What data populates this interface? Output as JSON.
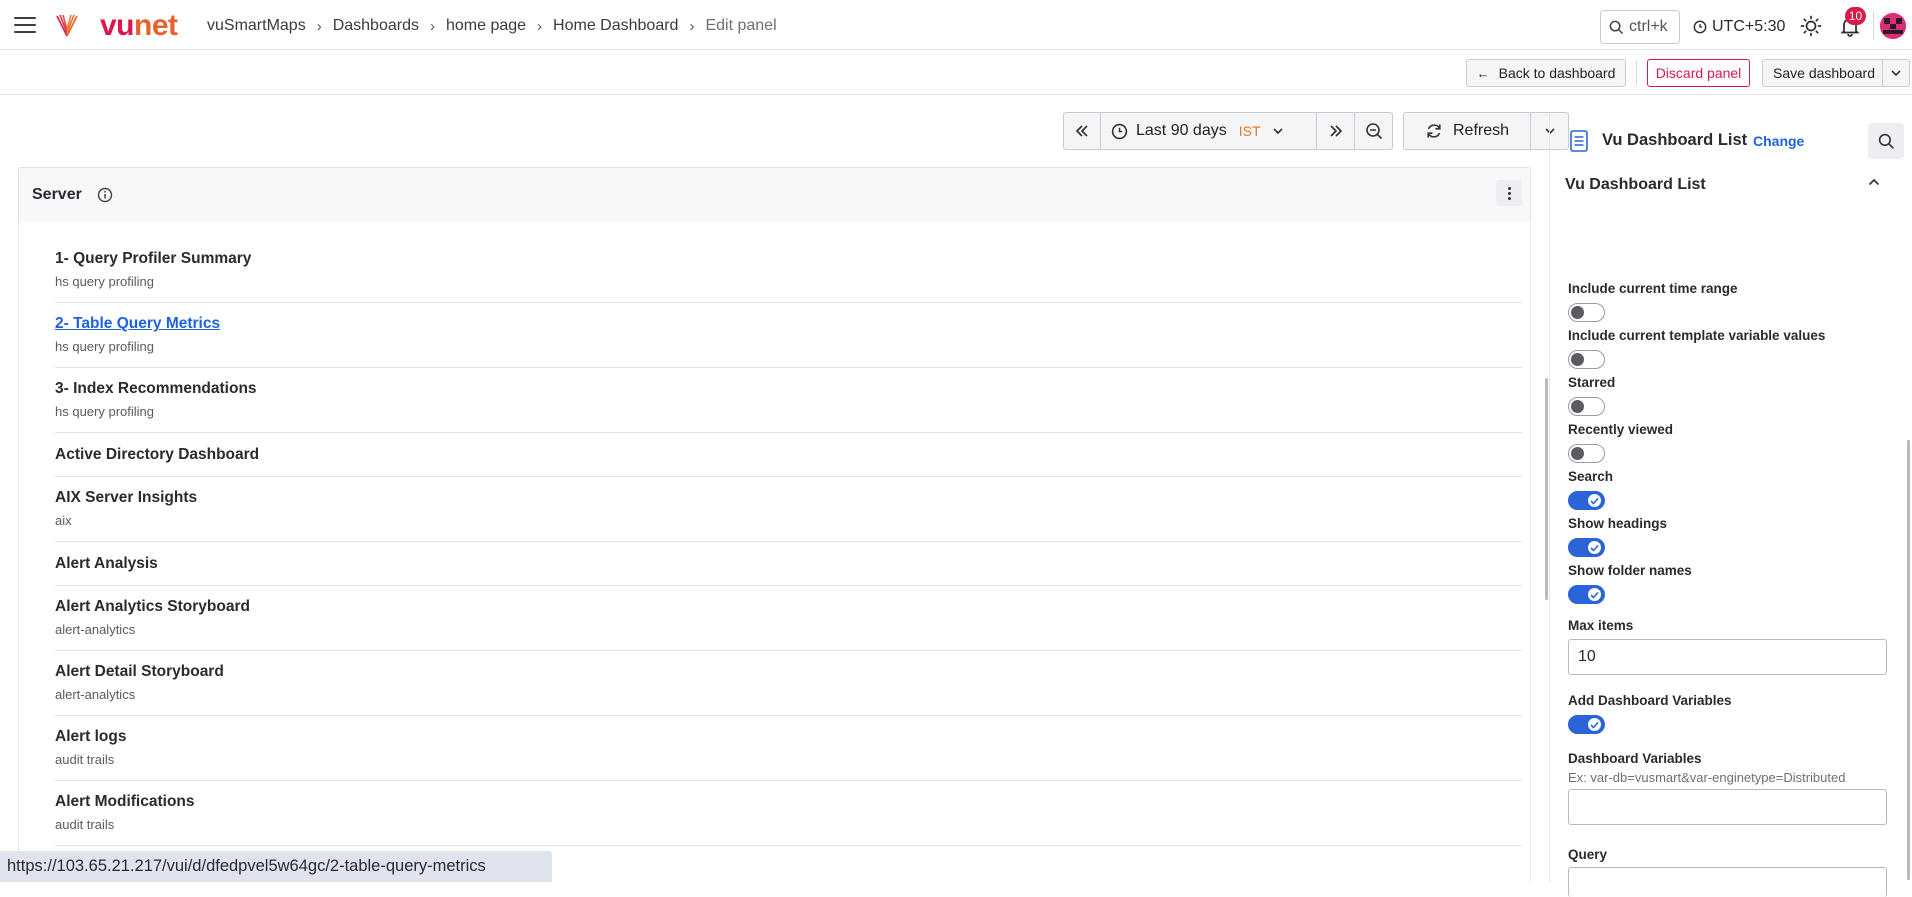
{
  "header": {
    "logo_vu": "vu",
    "logo_net": "net",
    "breadcrumb": [
      "vuSmartMaps",
      "Dashboards",
      "home page",
      "Home Dashboard",
      "Edit panel"
    ],
    "search_placeholder": "ctrl+k",
    "timezone": "UTC+5:30",
    "notification_count": "10"
  },
  "actions": {
    "back": "Back to dashboard",
    "discard": "Discard panel",
    "save": "Save dashboard"
  },
  "timebar": {
    "range": "Last 90 days",
    "tz": "IST",
    "refresh": "Refresh"
  },
  "panel": {
    "title": "Server",
    "items": [
      {
        "title": "1- Query Profiler Summary",
        "sub": "hs query profiling"
      },
      {
        "title": "2- Table Query Metrics",
        "sub": "hs query profiling",
        "link": true
      },
      {
        "title": "3- Index Recommendations",
        "sub": "hs query profiling"
      },
      {
        "title": "Active Directory Dashboard",
        "sub": ""
      },
      {
        "title": "AIX Server Insights",
        "sub": "aix"
      },
      {
        "title": "Alert Analysis",
        "sub": ""
      },
      {
        "title": "Alert Analytics Storyboard",
        "sub": "alert-analytics"
      },
      {
        "title": "Alert Detail Storyboard",
        "sub": "alert-analytics"
      },
      {
        "title": "Alert logs",
        "sub": "audit trails"
      },
      {
        "title": "Alert Modifications",
        "sub": "audit trails"
      }
    ]
  },
  "status_url": "https://103.65.21.217/vui/d/dfedpvel5w64gc/2-table-query-metrics",
  "sidepanel": {
    "viz_name": "Vu Dashboard List",
    "change": "Change",
    "section": "Vu Dashboard List",
    "options": [
      {
        "label": "Include current time range",
        "on": false
      },
      {
        "label": "Include current template variable values",
        "on": false
      },
      {
        "label": "Starred",
        "on": false
      },
      {
        "label": "Recently viewed",
        "on": false
      },
      {
        "label": "Search",
        "on": true
      },
      {
        "label": "Show headings",
        "on": true
      },
      {
        "label": "Show folder names",
        "on": true
      }
    ],
    "max_items_label": "Max items",
    "max_items_value": "10",
    "add_vars_label": "Add Dashboard Variables",
    "add_vars_on": true,
    "dash_vars_label": "Dashboard Variables",
    "dash_vars_hint": "Ex: var-db=vusmart&var-enginetype=Distributed",
    "query_label": "Query"
  },
  "colors": {
    "brand_primary": "#d9184b",
    "brand_secondary": "#e8612a",
    "accent_blue": "#2a64d8",
    "link_blue": "#1f62e0",
    "tz_orange": "#e07a1a"
  }
}
